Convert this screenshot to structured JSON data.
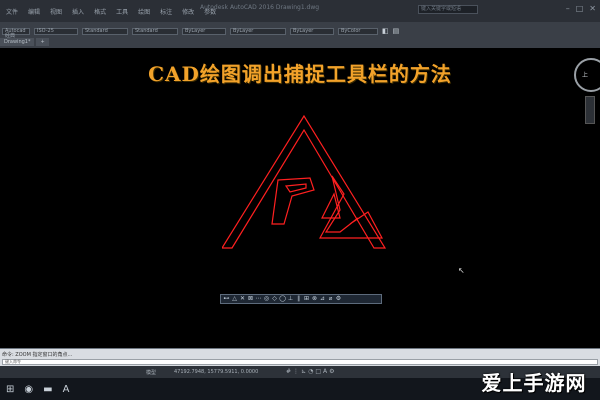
{
  "app": {
    "title": "Autodesk AutoCAD 2016 Drawing1.dwg",
    "search_placeholder": "键入关键字或短语"
  },
  "menu": {
    "items": [
      "文件",
      "编辑",
      "视图",
      "插入",
      "格式",
      "工具",
      "绘图",
      "标注",
      "修改",
      "参数"
    ]
  },
  "toolbar": {
    "layer_combo": "ISO-25",
    "text_style": "Standard",
    "dim_style": "Standard",
    "color_combo": "ByLayer",
    "linetype_combo": "ByLayer",
    "lineweight_combo": "ByLayer",
    "plot_combo": "ByColor",
    "tab_drawing": "Drawing1*",
    "tab_plus": "+",
    "workspace_combo": "Autocad 经典"
  },
  "title": {
    "text": "CAD绘图调出捕捉工具栏的方法"
  },
  "viewcube": {
    "label": "上"
  },
  "command": {
    "history": "命令: ZOOM 指定窗口的角点...",
    "prompt": "键入命令"
  },
  "status": {
    "coords": "47192.7948, 15779.5911, 0.0000",
    "mode": "模型"
  },
  "watermark": {
    "text": "爱上手游网"
  },
  "colors": {
    "canvas": "#000000",
    "title": "#f2a22a",
    "drawing_line": "#ff2020",
    "toolbar": "#3a3f47"
  },
  "icons": {
    "snapbar": [
      "endpoint-snap-icon",
      "midpoint-snap-icon",
      "intersection-snap-icon",
      "apparent-intersection-icon",
      "extension-snap-icon",
      "center-snap-icon",
      "quadrant-snap-icon",
      "tangent-snap-icon",
      "perpendicular-snap-icon",
      "parallel-snap-icon",
      "insert-snap-icon",
      "node-snap-icon",
      "nearest-snap-icon",
      "none-snap-icon",
      "osnap-settings-icon"
    ]
  }
}
